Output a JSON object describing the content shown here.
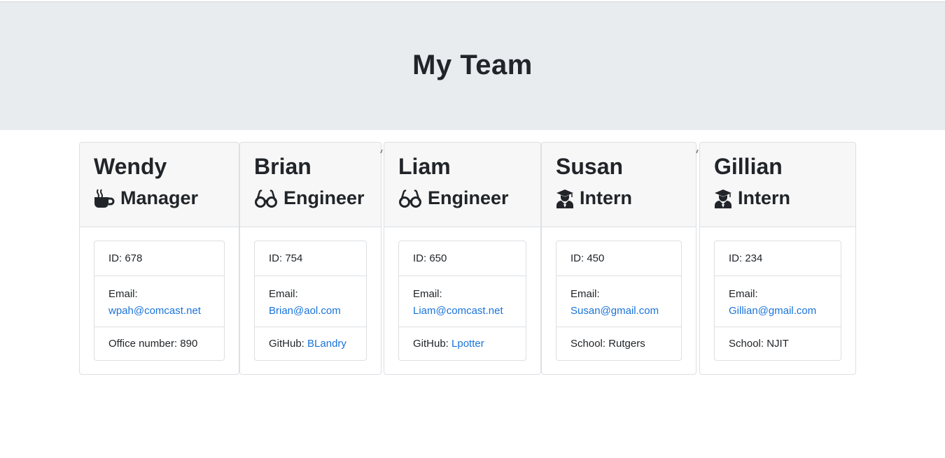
{
  "page": {
    "title": "My Team"
  },
  "team": [
    {
      "name": "Wendy",
      "role": "Manager",
      "role_icon": "coffee-icon",
      "id_label": "ID: 678",
      "email_label": "Email:",
      "email": "wpah@comcast.net",
      "extra_label": "Office number: 890",
      "extra_link": ""
    },
    {
      "name": "Brian",
      "role": "Engineer",
      "role_icon": "glasses-icon",
      "id_label": "ID: 754",
      "email_label": "Email:",
      "email": "Brian@aol.com",
      "extra_label": "GitHub: ",
      "extra_link": "BLandry"
    },
    {
      "name": "Liam",
      "role": "Engineer",
      "role_icon": "glasses-icon",
      "id_label": "ID: 650",
      "email_label": "Email:",
      "email": "Liam@comcast.net",
      "extra_label": "GitHub: ",
      "extra_link": "Lpotter"
    },
    {
      "name": "Susan",
      "role": "Intern",
      "role_icon": "graduate-icon",
      "id_label": "ID: 450",
      "email_label": "Email:",
      "email": "Susan@gmail.com",
      "extra_label": "School: Rutgers",
      "extra_link": ""
    },
    {
      "name": "Gillian",
      "role": "Intern",
      "role_icon": "graduate-icon",
      "id_label": "ID: 234",
      "email_label": "Email:",
      "email": "Gillian@gmail.com",
      "extra_label": "School: NJIT",
      "extra_link": ""
    }
  ],
  "colors": {
    "header_bg": "#e9ecef",
    "card_header_bg": "#f7f7f7",
    "link": "#1a73d9",
    "text": "#212529"
  }
}
